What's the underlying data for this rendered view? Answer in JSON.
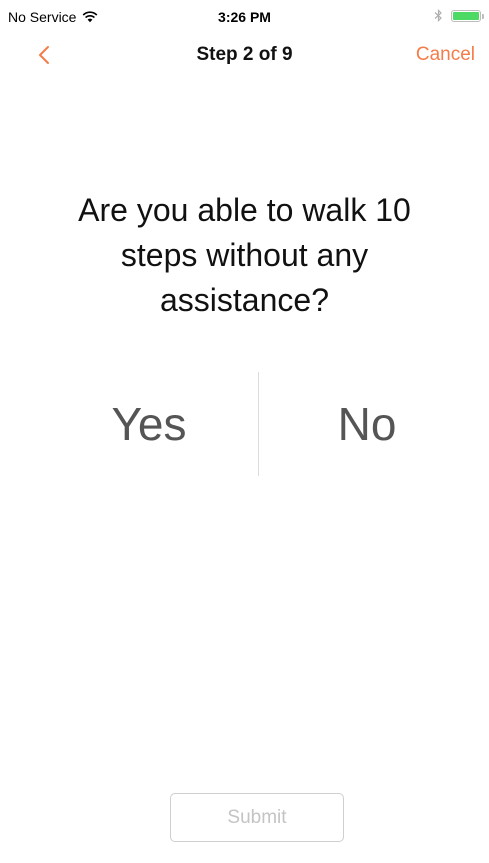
{
  "status_bar": {
    "carrier": "No Service",
    "time": "3:26 PM",
    "battery_level": 1.0,
    "battery_color": "#4cd964"
  },
  "nav": {
    "back_icon": "chevron-left-icon",
    "title": "Step 2 of 9",
    "cancel_label": "Cancel",
    "accent_color": "#f47c48"
  },
  "question": {
    "text": "Are you able to walk 10 steps without any assistance?"
  },
  "options": {
    "yes_label": "Yes",
    "no_label": "No"
  },
  "submit": {
    "label": "Submit",
    "enabled": false
  }
}
